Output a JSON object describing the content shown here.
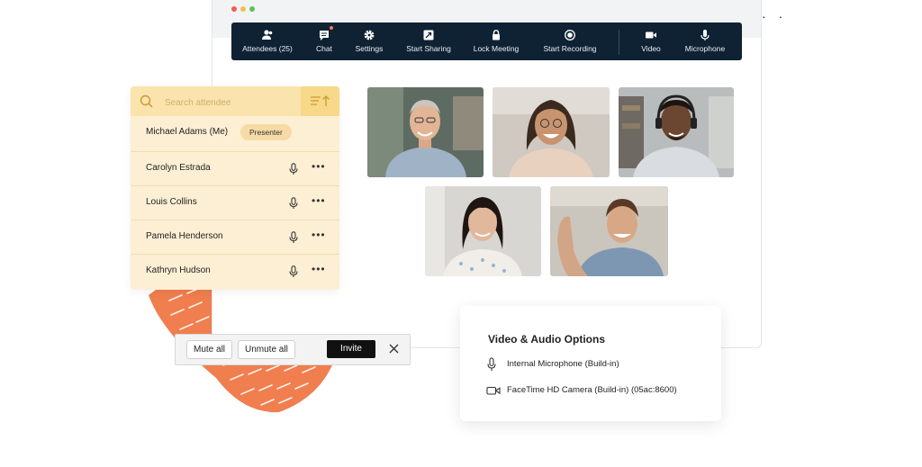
{
  "toolbar": {
    "attendees": "Attendees (25)",
    "chat": "Chat",
    "settings": "Settings",
    "start_sharing": "Start Sharing",
    "lock_meeting": "Lock Meeting",
    "start_recording": "Start Recording",
    "video": "Video",
    "microphone": "Microphone"
  },
  "attendees_panel": {
    "search_placeholder": "Search attendee",
    "attendees": [
      {
        "name": "Michael Adams (Me)",
        "badge": "Presenter"
      },
      {
        "name": "Carolyn Estrada"
      },
      {
        "name": "Louis Collins"
      },
      {
        "name": "Pamela Henderson"
      },
      {
        "name": "Kathryn Hudson"
      }
    ]
  },
  "action_bar": {
    "mute_all": "Mute all",
    "unmute_all": "Unmute all",
    "invite": "Invite"
  },
  "options_card": {
    "title": "Video & Audio Options",
    "microphone": "Internal Microphone (Build-in)",
    "camera": "FaceTime HD Camera (Build-in) (05ac:8600)"
  },
  "icons": [
    "attendees-icon",
    "chat-icon",
    "settings-icon",
    "share-icon",
    "lock-icon",
    "record-icon",
    "video-icon",
    "microphone-icon",
    "search-icon",
    "sort-icon",
    "mic-icon",
    "more-icon",
    "close-icon",
    "camera-icon"
  ],
  "colors": {
    "toolbar_bg": "#0f2233",
    "panel_bg": "#fdefd4",
    "panel_header": "#fbe3ad",
    "accent_orange": "#f07e4e",
    "invite_bg": "#111111"
  }
}
